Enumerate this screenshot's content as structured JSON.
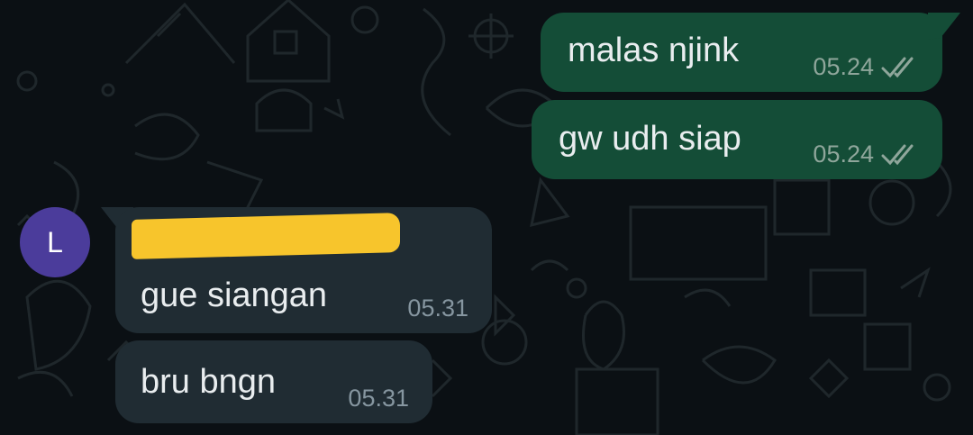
{
  "messages": [
    {
      "direction": "outgoing",
      "text": "malas njink",
      "time": "05.24",
      "status": "double-check-icon"
    },
    {
      "direction": "outgoing",
      "text": "gw udh siap",
      "time": "05.24",
      "status": "double-check-icon"
    },
    {
      "direction": "incoming",
      "text": "gue siangan",
      "time": "05.31"
    },
    {
      "direction": "incoming",
      "text": "bru bngn",
      "time": "05.31"
    }
  ],
  "sender": {
    "avatar_initial": "L",
    "name": "",
    "name_redacted": true
  },
  "colors": {
    "background": "#0b1014",
    "outgoing_bubble": "#144d37",
    "incoming_bubble": "#202c33",
    "avatar": "#4b3c9b",
    "redaction": "#f7c52c"
  }
}
